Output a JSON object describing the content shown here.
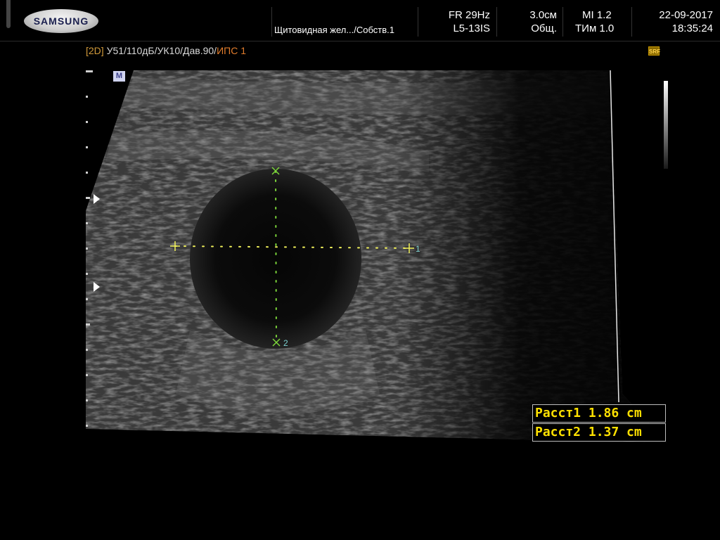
{
  "header": {
    "brand": "SAMSUNG",
    "preset": "Щитовидная жел.../Собств.1",
    "frame_rate": "FR 29Hz",
    "probe": "L5-13IS",
    "depth": "3.0см",
    "preset_mode": "Общ.",
    "mi": "MI  1.2",
    "tib": "ТИм 1.0",
    "date": "22-09-2017",
    "time": "18:35:24"
  },
  "imaging_params": {
    "mode": "[2D]",
    "settings": "У51/110дБ/УК10/Дав.90/",
    "ips": "ИПС 1"
  },
  "icons": {
    "srf_badge": "SRF",
    "marker_badge": "M"
  },
  "caliper_labels": {
    "first": "1",
    "second": "2"
  },
  "measurements": [
    {
      "label": "Расст1",
      "value": "1.86 cm"
    },
    {
      "label": "Расст2",
      "value": "1.37 cm"
    }
  ],
  "colors": {
    "measurement_text": "#ffe100",
    "caliper_horizontal": "#f0f05a",
    "caliper_vertical": "#7cd63a",
    "mode_label": "#d19a3a"
  }
}
